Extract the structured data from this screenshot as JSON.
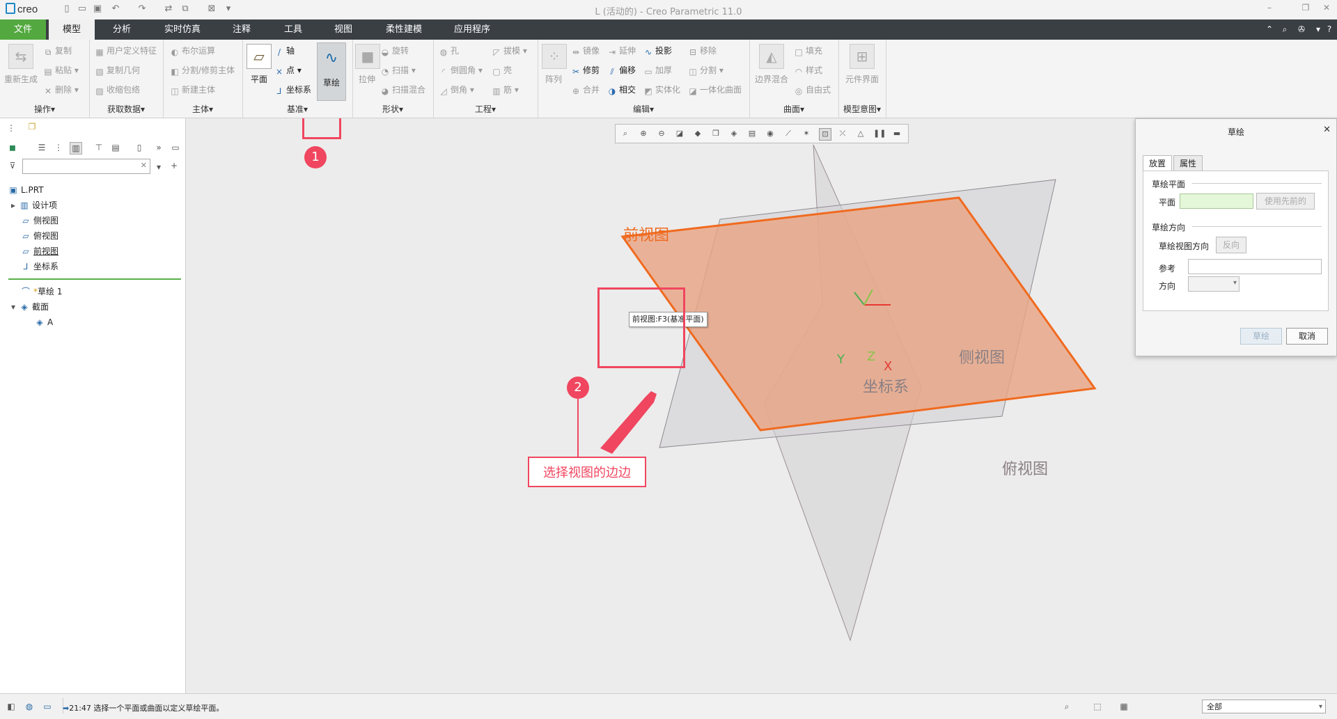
{
  "app": {
    "logo": "creo",
    "window_title": "L (活动的) - Creo Parametric 11.0"
  },
  "tabs": [
    "文件",
    "模型",
    "分析",
    "实时仿真",
    "注释",
    "工具",
    "视图",
    "柔性建模",
    "应用程序"
  ],
  "ribbon": {
    "ops": {
      "regen": "重新生成",
      "copy": "复制",
      "paste": "粘贴",
      "delete": "删除",
      "label": "操作"
    },
    "getdata": {
      "udf": "用户定义特征",
      "copygeom": "复制几何",
      "shrinkwrap": "收缩包络",
      "label": "获取数据"
    },
    "body": {
      "boolean": "布尔运算",
      "splittrim": "分割/修剪主体",
      "newbody": "新建主体",
      "label": "主体"
    },
    "datum": {
      "plane": "平面",
      "axis": "轴",
      "point": "点",
      "csys": "坐标系",
      "sketch": "草绘",
      "label": "基准"
    },
    "shapes": {
      "extrude": "拉伸",
      "revolve": "旋转",
      "sweep": "扫描",
      "sweptblend": "扫描混合",
      "label": "形状"
    },
    "eng": {
      "hole": "孔",
      "draft": "拔模",
      "round": "倒圆角",
      "shell": "壳",
      "chamfer": "倒角",
      "rib": "筋",
      "label": "工程"
    },
    "edit": {
      "pattern": "阵列",
      "mirror": "镜像",
      "extend": "延伸",
      "project": "投影",
      "remove": "移除",
      "trim": "修剪",
      "offset": "偏移",
      "thicken": "加厚",
      "split": "分割",
      "merge": "合并",
      "intersect": "相交",
      "solidify": "实体化",
      "unify": "一体化曲面",
      "label": "编辑"
    },
    "surf": {
      "boundary": "边界混合",
      "fill": "填充",
      "style": "样式",
      "freestyle": "自由式",
      "label": "曲面"
    },
    "intent": {
      "compif": "元件界面",
      "label": "模型意图"
    }
  },
  "tree": {
    "filter_placeholder": "",
    "items": [
      "L.PRT",
      "设计项",
      "侧视图",
      "俯视图",
      "前视图",
      "坐标系",
      "草绘 1",
      "截面",
      "A"
    ]
  },
  "viewport": {
    "label_front": "前视图",
    "label_side": "侧视图",
    "label_top": "俯视图",
    "label_csys": "坐标系",
    "axis_x": "X",
    "axis_y": "Y",
    "axis_z": "Z",
    "tooltip": "前视图:F3(基准平面)",
    "callout1": "1",
    "callout2": "2",
    "callout_text": "选择视图的边边"
  },
  "dialog": {
    "title": "草绘",
    "tab_placement": "放置",
    "tab_properties": "属性",
    "sketch_plane": "草绘平面",
    "plane_label": "平面",
    "use_previous": "使用先前的",
    "orientation": "草绘方向",
    "view_dir": "草绘视图方向",
    "flip": "反向",
    "reference": "参考",
    "direction": "方向",
    "sketch_btn": "草绘",
    "cancel_btn": "取消"
  },
  "status": {
    "message": "21:47 选择一个平面或曲面以定义草绘平面。",
    "filter": "全部"
  },
  "colors": {
    "file_tab": "#53a93f",
    "tab_bar": "#3a3f44",
    "front_plane_fill": "#e8a483",
    "front_plane_edge": "#f06a1f",
    "highlight": "#f0465f"
  }
}
